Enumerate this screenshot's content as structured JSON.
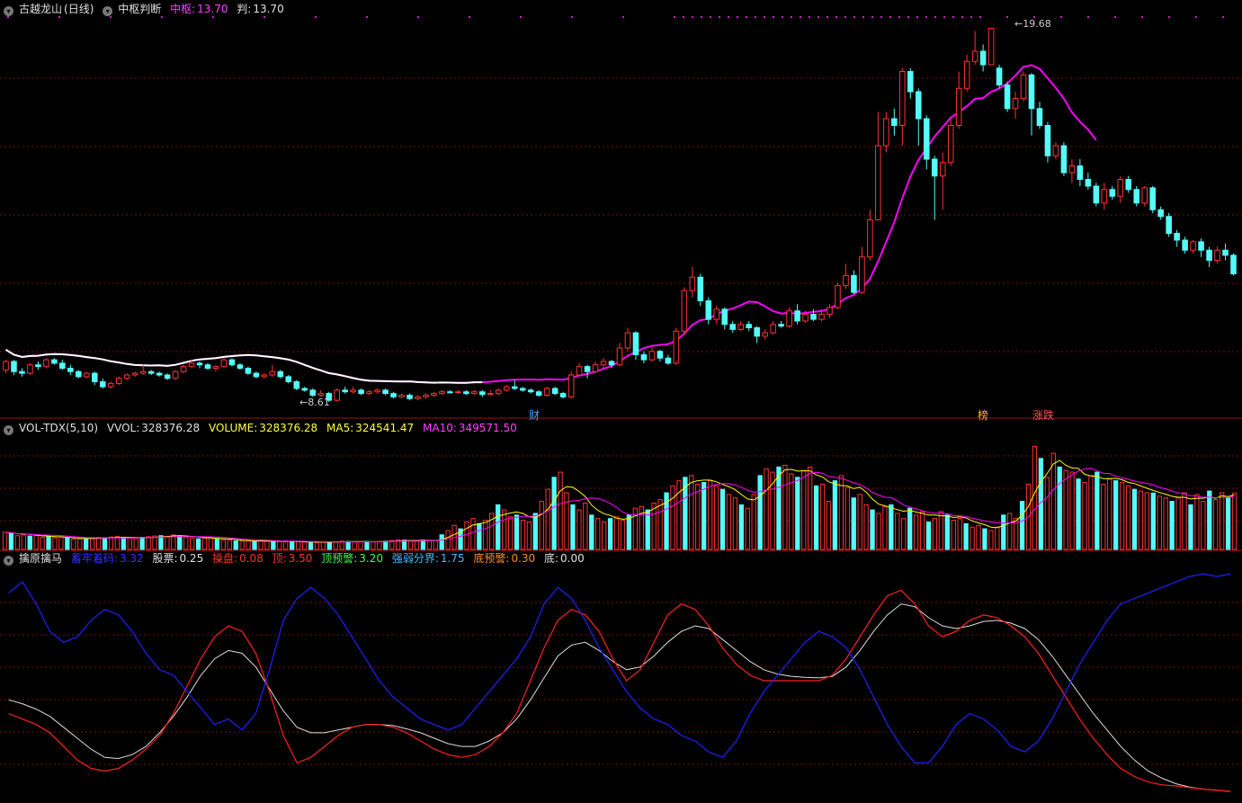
{
  "panel1": {
    "stock_name": "古越龙山",
    "period": "(日线)",
    "indicator": "中枢判断",
    "label_zhongshu": "中枢:",
    "value_zhongshu": "13.70",
    "label_pan": "判:",
    "value_pan": "13.70",
    "high_label": "19.68",
    "low_label": "8.61",
    "markers": [
      "财",
      "榜",
      "涨跌"
    ]
  },
  "panel2": {
    "indicator": "VOL-TDX(5,10)",
    "label_vvol": "VVOL:",
    "value_vvol": "328376.28",
    "label_volume": "VOLUME:",
    "value_volume": "328376.28",
    "label_ma5": "MA5:",
    "value_ma5": "324541.47",
    "label_ma10": "MA10:",
    "value_ma10": "349571.50"
  },
  "panel3": {
    "indicator": "擒原擒马",
    "label_a": "蓄牢着码:",
    "value_a": "3.32",
    "label_b": "股票:",
    "value_b": "0.25",
    "label_c": "操盘:",
    "value_c": "0.08",
    "label_d": "顶:",
    "value_d": "3.50",
    "label_e": "顶预警:",
    "value_e": "3.20",
    "label_f": "强弱分界:",
    "value_f": "1.75",
    "label_g": "底预警:",
    "value_g": "0.30",
    "label_h": "底:",
    "value_h": "0.00"
  },
  "colors": {
    "up": "#ff3232",
    "down": "#54fcfc",
    "ma_white": "#ffffff",
    "ma_magenta": "#ff00ff",
    "ma5": "#ffff00",
    "osc_red": "#ff2020",
    "osc_blue": "#2020ff",
    "osc_white": "#dddddd",
    "grid": "#7a1010"
  },
  "chart_data": {
    "type": "candlestick",
    "price_range": [
      8.2,
      20.2
    ],
    "volume_max": 660000,
    "osc_range": [
      -0.35,
      3.85
    ],
    "highest": 19.68,
    "lowest": 8.61,
    "candles": [
      [
        9.55,
        9.8,
        9.85,
        9.45
      ],
      [
        9.8,
        9.5,
        9.85,
        9.4
      ],
      [
        9.5,
        9.45,
        9.6,
        9.35
      ],
      [
        9.45,
        9.7,
        9.75,
        9.4
      ],
      [
        9.7,
        9.65,
        9.8,
        9.55
      ],
      [
        9.65,
        9.85,
        9.9,
        9.6
      ],
      [
        9.85,
        9.75,
        9.9,
        9.7
      ],
      [
        9.75,
        9.6,
        9.85,
        9.55
      ],
      [
        9.6,
        9.5,
        9.7,
        9.4
      ],
      [
        9.5,
        9.35,
        9.55,
        9.3
      ],
      [
        9.35,
        9.45,
        9.5,
        9.3
      ],
      [
        9.45,
        9.2,
        9.5,
        9.1
      ],
      [
        9.2,
        9.05,
        9.3,
        9.0
      ],
      [
        9.05,
        9.15,
        9.2,
        9.0
      ],
      [
        9.15,
        9.3,
        9.35,
        9.1
      ],
      [
        9.3,
        9.4,
        9.45,
        9.25
      ],
      [
        9.4,
        9.45,
        9.5,
        9.35
      ],
      [
        9.45,
        9.5,
        9.7,
        9.4
      ],
      [
        9.5,
        9.45,
        9.55,
        9.4
      ],
      [
        9.45,
        9.4,
        9.5,
        9.35
      ],
      [
        9.4,
        9.3,
        9.45,
        9.25
      ],
      [
        9.3,
        9.5,
        9.55,
        9.25
      ],
      [
        9.5,
        9.65,
        9.7,
        9.45
      ],
      [
        9.65,
        9.75,
        9.85,
        9.6
      ],
      [
        9.75,
        9.7,
        9.8,
        9.6
      ],
      [
        9.7,
        9.6,
        9.75,
        9.55
      ],
      [
        9.6,
        9.65,
        9.7,
        9.5
      ],
      [
        9.65,
        9.85,
        9.9,
        9.6
      ],
      [
        9.85,
        9.7,
        9.9,
        9.65
      ],
      [
        9.7,
        9.6,
        9.75,
        9.55
      ],
      [
        9.6,
        9.45,
        9.65,
        9.4
      ],
      [
        9.45,
        9.35,
        9.5,
        9.3
      ],
      [
        9.35,
        9.4,
        9.45,
        9.3
      ],
      [
        9.4,
        9.5,
        9.7,
        9.35
      ],
      [
        9.5,
        9.35,
        9.55,
        9.3
      ],
      [
        9.35,
        9.2,
        9.4,
        9.15
      ],
      [
        9.2,
        9.0,
        9.25,
        8.95
      ],
      [
        9.0,
        8.95,
        9.05,
        8.9
      ],
      [
        8.95,
        8.8,
        9.0,
        8.75
      ],
      [
        8.8,
        8.85,
        8.95,
        8.75
      ],
      [
        8.85,
        8.65,
        8.9,
        8.6
      ],
      [
        8.65,
        8.95,
        9.0,
        8.61
      ],
      [
        8.95,
        8.9,
        9.05,
        8.85
      ],
      [
        8.9,
        8.95,
        9.05,
        8.85
      ],
      [
        8.95,
        8.85,
        9.0,
        8.8
      ],
      [
        8.85,
        8.9,
        8.95,
        8.8
      ],
      [
        8.9,
        8.95,
        9.0,
        8.85
      ],
      [
        8.95,
        8.85,
        9.0,
        8.8
      ],
      [
        8.85,
        8.75,
        8.9,
        8.7
      ],
      [
        8.75,
        8.8,
        8.85,
        8.7
      ],
      [
        8.8,
        8.7,
        8.85,
        8.65
      ],
      [
        8.7,
        8.75,
        8.8,
        8.65
      ],
      [
        8.75,
        8.8,
        8.85,
        8.7
      ],
      [
        8.8,
        8.85,
        8.9,
        8.75
      ],
      [
        8.85,
        8.9,
        8.95,
        8.8
      ],
      [
        8.9,
        8.88,
        8.95,
        8.85
      ],
      [
        8.88,
        8.9,
        8.95,
        8.85
      ],
      [
        8.9,
        8.85,
        8.95,
        8.8
      ],
      [
        8.85,
        8.9,
        8.95,
        8.8
      ],
      [
        8.9,
        8.82,
        8.95,
        8.75
      ],
      [
        8.82,
        8.85,
        8.95,
        8.8
      ],
      [
        8.85,
        8.95,
        9.0,
        8.8
      ],
      [
        8.95,
        9.05,
        9.1,
        8.9
      ],
      [
        9.05,
        9.0,
        9.25,
        8.95
      ],
      [
        9.0,
        8.95,
        9.05,
        8.9
      ],
      [
        8.95,
        8.9,
        9.0,
        8.85
      ],
      [
        8.9,
        8.8,
        8.95,
        8.75
      ],
      [
        8.8,
        9.0,
        9.05,
        8.75
      ],
      [
        9.0,
        8.85,
        9.05,
        8.8
      ],
      [
        8.85,
        8.75,
        8.9,
        8.7
      ],
      [
        8.75,
        9.4,
        9.5,
        8.7
      ],
      [
        9.4,
        9.65,
        9.75,
        9.35
      ],
      [
        9.65,
        9.5,
        9.7,
        9.3
      ],
      [
        9.5,
        9.7,
        9.8,
        9.45
      ],
      [
        9.7,
        9.8,
        9.9,
        9.6
      ],
      [
        9.8,
        9.7,
        9.85,
        9.6
      ],
      [
        9.7,
        10.2,
        10.35,
        9.65
      ],
      [
        10.2,
        10.65,
        10.8,
        10.1
      ],
      [
        10.65,
        10.0,
        10.7,
        9.85
      ],
      [
        10.0,
        9.85,
        10.1,
        9.75
      ],
      [
        9.85,
        10.1,
        10.2,
        9.8
      ],
      [
        10.1,
        9.9,
        10.15,
        9.8
      ],
      [
        9.9,
        9.75,
        10.0,
        9.7
      ],
      [
        9.75,
        10.7,
        10.8,
        9.7
      ],
      [
        10.7,
        11.9,
        12.0,
        10.6
      ],
      [
        11.9,
        12.3,
        12.6,
        11.7
      ],
      [
        12.3,
        11.6,
        12.4,
        11.45
      ],
      [
        11.6,
        11.05,
        11.7,
        10.9
      ],
      [
        11.05,
        11.35,
        11.45,
        10.9
      ],
      [
        11.35,
        10.9,
        11.4,
        10.75
      ],
      [
        10.9,
        10.75,
        11.0,
        10.65
      ],
      [
        10.75,
        10.9,
        11.0,
        10.7
      ],
      [
        10.9,
        10.8,
        11.0,
        10.7
      ],
      [
        10.8,
        10.55,
        10.85,
        10.35
      ],
      [
        10.55,
        10.65,
        10.75,
        10.45
      ],
      [
        10.65,
        10.9,
        11.0,
        10.6
      ],
      [
        10.9,
        10.85,
        11.0,
        10.8
      ],
      [
        10.85,
        11.3,
        11.4,
        10.8
      ],
      [
        11.3,
        11.0,
        11.5,
        10.9
      ],
      [
        11.0,
        11.2,
        11.3,
        10.95
      ],
      [
        11.2,
        11.05,
        11.35,
        11.0
      ],
      [
        11.05,
        11.2,
        11.35,
        11.0
      ],
      [
        11.2,
        11.4,
        11.5,
        11.1
      ],
      [
        11.4,
        12.05,
        12.15,
        11.35
      ],
      [
        12.05,
        12.35,
        12.7,
        11.95
      ],
      [
        12.35,
        11.85,
        12.5,
        11.8
      ],
      [
        11.85,
        12.9,
        13.2,
        11.8
      ],
      [
        12.9,
        14.0,
        14.3,
        12.8
      ],
      [
        14.0,
        16.2,
        17.2,
        14.0
      ],
      [
        16.2,
        17.0,
        17.2,
        16.0
      ],
      [
        17.0,
        16.8,
        17.3,
        16.5
      ],
      [
        16.8,
        18.4,
        18.5,
        16.2
      ],
      [
        18.4,
        17.8,
        18.5,
        17.6
      ],
      [
        17.8,
        17.0,
        17.9,
        16.2
      ],
      [
        17.0,
        15.8,
        17.1,
        15.5
      ],
      [
        15.8,
        15.3,
        15.9,
        14.0
      ],
      [
        15.3,
        15.7,
        16.0,
        14.3
      ],
      [
        15.7,
        16.8,
        17.0,
        15.6
      ],
      [
        16.8,
        17.9,
        18.4,
        16.7
      ],
      [
        17.9,
        18.7,
        18.9,
        17.8
      ],
      [
        18.7,
        19.0,
        19.6,
        18.6
      ],
      [
        19.0,
        18.6,
        19.2,
        18.4
      ],
      [
        18.6,
        19.68,
        19.68,
        18.6
      ],
      [
        18.5,
        18.0,
        18.6,
        17.9
      ],
      [
        18.0,
        17.3,
        18.1,
        17.2
      ],
      [
        17.3,
        17.6,
        17.8,
        17.0
      ],
      [
        17.6,
        18.3,
        18.4,
        17.5
      ],
      [
        18.3,
        17.3,
        18.35,
        16.5
      ],
      [
        17.3,
        16.8,
        17.5,
        16.7
      ],
      [
        16.8,
        15.9,
        16.9,
        15.7
      ],
      [
        15.9,
        16.2,
        16.3,
        15.8
      ],
      [
        16.2,
        15.4,
        16.3,
        15.3
      ],
      [
        15.4,
        15.6,
        15.8,
        15.1
      ],
      [
        15.6,
        15.2,
        15.8,
        15.0
      ],
      [
        15.2,
        15.0,
        15.4,
        14.9
      ],
      [
        15.0,
        14.5,
        15.1,
        14.4
      ],
      [
        14.5,
        14.9,
        15.1,
        14.3
      ],
      [
        14.9,
        14.7,
        15.0,
        14.6
      ],
      [
        14.7,
        15.2,
        15.3,
        14.5
      ],
      [
        15.2,
        14.9,
        15.3,
        14.8
      ],
      [
        14.9,
        14.5,
        15.0,
        14.4
      ],
      [
        14.5,
        14.95,
        15.0,
        14.4
      ],
      [
        14.95,
        14.3,
        15.0,
        14.2
      ],
      [
        14.3,
        14.1,
        14.4,
        14.0
      ],
      [
        14.1,
        13.6,
        14.2,
        13.5
      ],
      [
        13.6,
        13.4,
        13.7,
        13.2
      ],
      [
        13.4,
        13.1,
        13.5,
        13.0
      ],
      [
        13.1,
        13.35,
        13.4,
        13.0
      ],
      [
        13.35,
        13.1,
        13.45,
        12.9
      ],
      [
        13.1,
        12.8,
        13.2,
        12.6
      ],
      [
        12.8,
        13.1,
        13.2,
        12.7
      ],
      [
        13.1,
        12.95,
        13.3,
        12.8
      ],
      [
        12.95,
        12.4,
        13.0,
        12.35
      ]
    ],
    "volume": [
      100000,
      95000,
      80000,
      85000,
      78000,
      82000,
      70000,
      76000,
      68000,
      72000,
      65000,
      60000,
      62000,
      64000,
      66000,
      70000,
      68000,
      72000,
      75000,
      70000,
      66000,
      64000,
      70000,
      74000,
      78000,
      80000,
      76000,
      84000,
      80000,
      72000,
      66000,
      62000,
      64000,
      70000,
      60000,
      56000,
      54000,
      50000,
      48000,
      50000,
      46000,
      52000,
      48000,
      50000,
      46000,
      44000,
      46000,
      45000,
      42000,
      44000,
      40000,
      42000,
      44000,
      46000,
      48000,
      46000,
      44000,
      45000,
      46000,
      44000,
      46000,
      48000,
      52000,
      56000,
      54000,
      50000,
      48000,
      54000,
      52000,
      50000,
      85000,
      110000,
      140000,
      120000,
      160000,
      180000,
      150000,
      170000,
      210000,
      260000,
      230000,
      190000,
      200000,
      170000,
      160000,
      210000,
      280000,
      350000,
      420000,
      450000,
      330000,
      260000,
      230000,
      270000,
      200000,
      180000,
      160000,
      180000,
      190000,
      170000,
      200000,
      240000,
      250000,
      230000,
      270000,
      290000,
      330000,
      370000,
      400000,
      420000,
      430000,
      380000,
      390000,
      400000,
      370000,
      350000,
      320000,
      300000,
      260000,
      240000,
      320000,
      430000,
      470000,
      450000,
      480000,
      490000,
      440000,
      420000,
      460000,
      480000,
      370000,
      380000,
      280000,
      400000,
      430000,
      360000,
      300000,
      320000,
      260000,
      230000,
      210000,
      250000,
      260000,
      210000,
      180000,
      240000,
      200000,
      220000,
      160000,
      180000,
      220000,
      200000,
      170000,
      180000,
      150000,
      130000,
      140000,
      120000,
      110000,
      130000,
      200000,
      210000,
      180000,
      280000,
      380000,
      600000,
      530000,
      420000,
      560000,
      480000,
      460000,
      450000,
      410000,
      390000,
      430000,
      450000,
      380000,
      410000,
      400000,
      390000,
      370000,
      350000,
      340000,
      330000,
      328376.28,
      310000,
      300000,
      280000,
      300000,
      330000,
      260000,
      320000,
      280000,
      340000,
      290000,
      330000,
      300000,
      328376.28
    ],
    "ma_white_range": [
      0,
      135
    ],
    "osc_red": [
      1.2,
      1.1,
      1.0,
      0.85,
      0.6,
      0.35,
      0.2,
      0.15,
      0.2,
      0.35,
      0.55,
      0.8,
      1.2,
      1.7,
      2.2,
      2.6,
      2.8,
      2.7,
      2.3,
      1.6,
      0.8,
      0.3,
      0.4,
      0.6,
      0.8,
      0.95,
      1.0,
      1.0,
      0.95,
      0.85,
      0.7,
      0.55,
      0.45,
      0.4,
      0.45,
      0.6,
      0.85,
      1.2,
      1.8,
      2.4,
      2.9,
      3.1,
      3.0,
      2.7,
      2.2,
      1.8,
      2.0,
      2.5,
      3.0,
      3.2,
      3.1,
      2.8,
      2.4,
      2.1,
      1.9,
      1.8,
      1.8,
      1.8,
      1.8,
      1.8,
      1.9,
      2.2,
      2.6,
      3.0,
      3.35,
      3.45,
      3.2,
      2.8,
      2.6,
      2.7,
      2.9,
      3.0,
      2.95,
      2.8,
      2.6,
      2.3,
      1.9,
      1.5,
      1.1,
      0.75,
      0.45,
      0.2,
      0.05,
      -0.05,
      -0.1,
      -0.12,
      -0.15,
      -0.18,
      -0.2,
      -0.22
    ],
    "osc_blue": [
      3.4,
      3.6,
      3.2,
      2.7,
      2.5,
      2.6,
      2.9,
      3.1,
      3.0,
      2.7,
      2.3,
      2.0,
      1.9,
      1.6,
      1.3,
      1.0,
      1.1,
      0.9,
      1.2,
      2.0,
      2.9,
      3.3,
      3.5,
      3.3,
      3.0,
      2.6,
      2.2,
      1.8,
      1.5,
      1.3,
      1.1,
      1.0,
      0.9,
      1.0,
      1.3,
      1.6,
      1.9,
      2.2,
      2.6,
      3.2,
      3.5,
      3.3,
      2.9,
      2.4,
      2.0,
      1.6,
      1.3,
      1.1,
      1.0,
      0.8,
      0.7,
      0.5,
      0.4,
      0.7,
      1.2,
      1.6,
      1.9,
      2.2,
      2.5,
      2.7,
      2.6,
      2.4,
      2.0,
      1.5,
      1.0,
      0.6,
      0.3,
      0.3,
      0.6,
      1.0,
      1.2,
      1.1,
      0.9,
      0.6,
      0.5,
      0.7,
      1.1,
      1.6,
      2.1,
      2.5,
      2.9,
      3.2,
      3.3,
      3.4,
      3.5,
      3.6,
      3.7,
      3.75,
      3.7,
      3.75
    ],
    "osc_white": [
      1.45,
      1.38,
      1.28,
      1.15,
      0.95,
      0.75,
      0.55,
      0.4,
      0.38,
      0.45,
      0.6,
      0.85,
      1.15,
      1.5,
      1.9,
      2.2,
      2.35,
      2.3,
      2.05,
      1.65,
      1.25,
      0.95,
      0.85,
      0.85,
      0.9,
      0.95,
      1.0,
      1.0,
      0.98,
      0.92,
      0.85,
      0.75,
      0.65,
      0.6,
      0.6,
      0.7,
      0.85,
      1.1,
      1.45,
      1.85,
      2.25,
      2.45,
      2.5,
      2.35,
      2.15,
      2.0,
      2.05,
      2.25,
      2.5,
      2.7,
      2.8,
      2.75,
      2.55,
      2.35,
      2.15,
      2.0,
      1.92,
      1.88,
      1.86,
      1.85,
      1.88,
      2.05,
      2.35,
      2.7,
      3.0,
      3.2,
      3.15,
      2.95,
      2.8,
      2.75,
      2.8,
      2.88,
      2.9,
      2.85,
      2.75,
      2.55,
      2.25,
      1.9,
      1.55,
      1.2,
      0.9,
      0.6,
      0.35,
      0.15,
      0.02,
      -0.08,
      -0.14,
      -0.18,
      -0.2,
      -0.22
    ]
  }
}
